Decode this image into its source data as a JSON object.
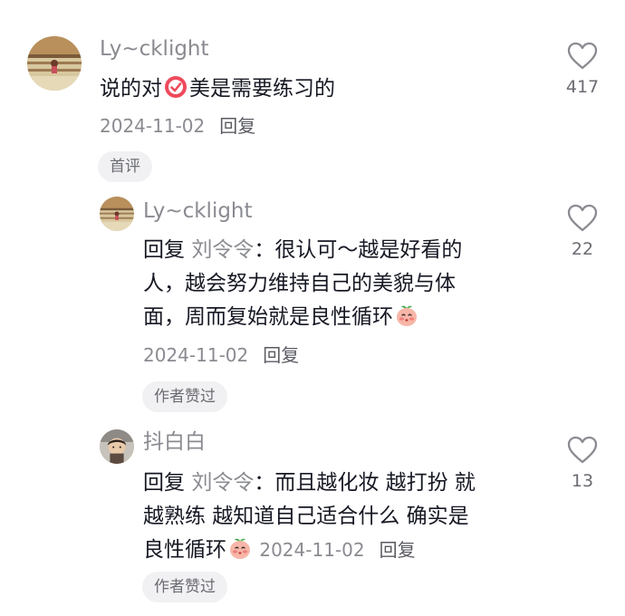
{
  "comments": [
    {
      "username": "Ly~cklight",
      "text_a": "说的对",
      "text_b": "美是需要练习的",
      "date": "2024-11-02",
      "reply_label": "回复",
      "tag": "首评",
      "likes": "417",
      "emoji": "check-mark-emoji"
    },
    {
      "username": "Ly~cklight",
      "reply_prefix": "回复 ",
      "mention": "刘令令",
      "colon": "：",
      "line1": "很认可～越是好看的",
      "line2": "人，越会努力维持自己的美貌与体",
      "line3": "面，周而复始就是良性循环",
      "date": "2024-11-02",
      "reply_label": "回复",
      "tag": "作者赞过",
      "likes": "22",
      "emoji": "peach-face-emoji"
    },
    {
      "username": "抖白白",
      "reply_prefix": "回复 ",
      "mention": "刘令令",
      "colon": "：",
      "line1": "而且越化妆 越打扮 就",
      "line2": "越熟练 越知道自己适合什么 确实是",
      "line3": "良性循环",
      "date": "2024-11-02",
      "reply_label": "回复",
      "tag": "作者赞过",
      "likes": "13",
      "emoji": "peach-face-emoji"
    }
  ]
}
